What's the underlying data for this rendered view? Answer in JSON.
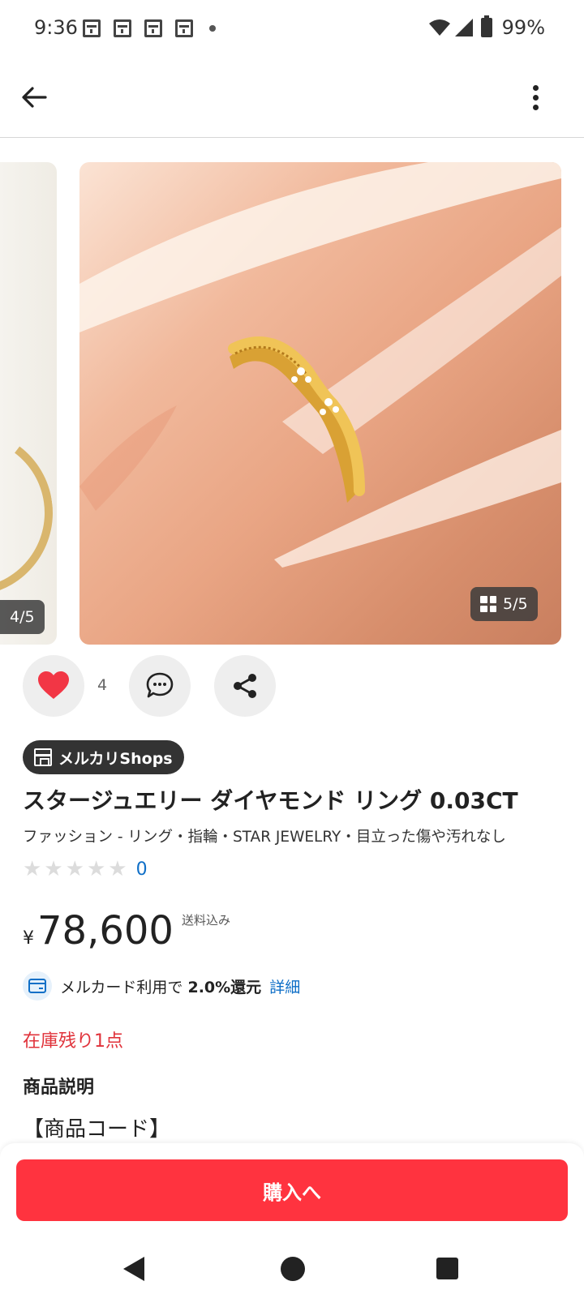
{
  "status_bar": {
    "time": "9:36",
    "battery_percent": "99%",
    "notification_icons": [
      "calendar-icon",
      "calendar-icon",
      "calendar-icon",
      "calendar-icon"
    ]
  },
  "app_bar": {
    "back_icon": "arrow-left-icon",
    "more_icon": "more-vertical-icon"
  },
  "gallery": {
    "prev_counter": "4/5",
    "current_counter": "5/5"
  },
  "actions": {
    "like_count": "4"
  },
  "product": {
    "shop_badge": "メルカリShops",
    "title": "スタージュエリー ダイヤモンド リング 0.03CT",
    "category": "ファッション - リング・指輪・STAR JEWELRY・目立った傷や汚れなし",
    "rating_count": "0",
    "rating_stars": 0,
    "currency_symbol": "¥",
    "price": "78,600",
    "shipping_note": "送料込み",
    "card_prefix": "メルカード利用で",
    "card_bold": "2.0%還元",
    "card_link": "詳細",
    "stock_text": "在庫残り1点",
    "description_heading": "商品説明",
    "description_first_line": "【商品コード】"
  },
  "buy_button": {
    "label": "購入へ"
  },
  "colors": {
    "accent_red": "#ff333f",
    "link_blue": "#0f6fc7",
    "stock_red": "#e0323a",
    "badge_dark": "#333333"
  }
}
